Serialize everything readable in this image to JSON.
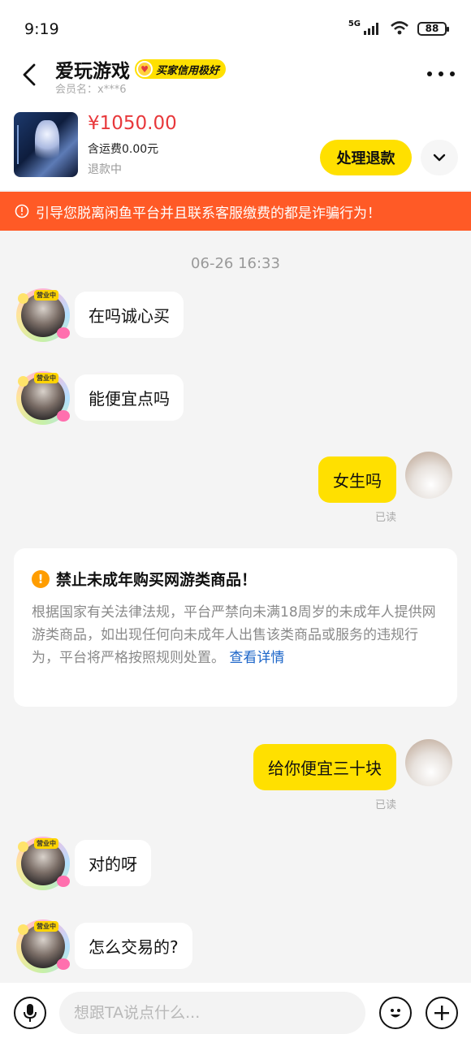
{
  "status_bar": {
    "time": "9:19",
    "network": "5G",
    "battery": "88"
  },
  "header": {
    "title": "爱玩游戏",
    "badge": "买家信用极好",
    "member": "会员名：x***6"
  },
  "product": {
    "price": "¥1050.00",
    "shipping": "含运费0.00元",
    "status": "退款中",
    "action_label": "处理退款"
  },
  "warning": {
    "text": "引导您脱离闲鱼平台并且联系客服缴费的都是诈骗行为！"
  },
  "chat": {
    "timestamp": "06-26 16:33",
    "messages": [
      {
        "from": "other",
        "text": "在吗诚心买"
      },
      {
        "from": "other",
        "text": "能便宜点吗"
      },
      {
        "from": "me",
        "text": "女生吗",
        "read": "已读"
      },
      {
        "from": "me",
        "text": "给你便宜三十块",
        "read": "已读"
      },
      {
        "from": "other",
        "text": "对的呀"
      },
      {
        "from": "other",
        "text": "怎么交易的?"
      }
    ],
    "avatar_tag": "营业中"
  },
  "notice": {
    "title": "禁止未成年购买网游类商品！",
    "body": "根据国家有关法律法规，平台严禁向未满18周岁的未成年人提供网游类商品，如出现任何向未成年人出售该类商品或服务的违规行为，平台将严格按照规则处置。",
    "link": "查看详情"
  },
  "input": {
    "placeholder": "想跟TA说点什么..."
  },
  "colors": {
    "accent_yellow": "#ffe000",
    "warning_orange": "#ff5a26",
    "price_red": "#e8383b"
  }
}
